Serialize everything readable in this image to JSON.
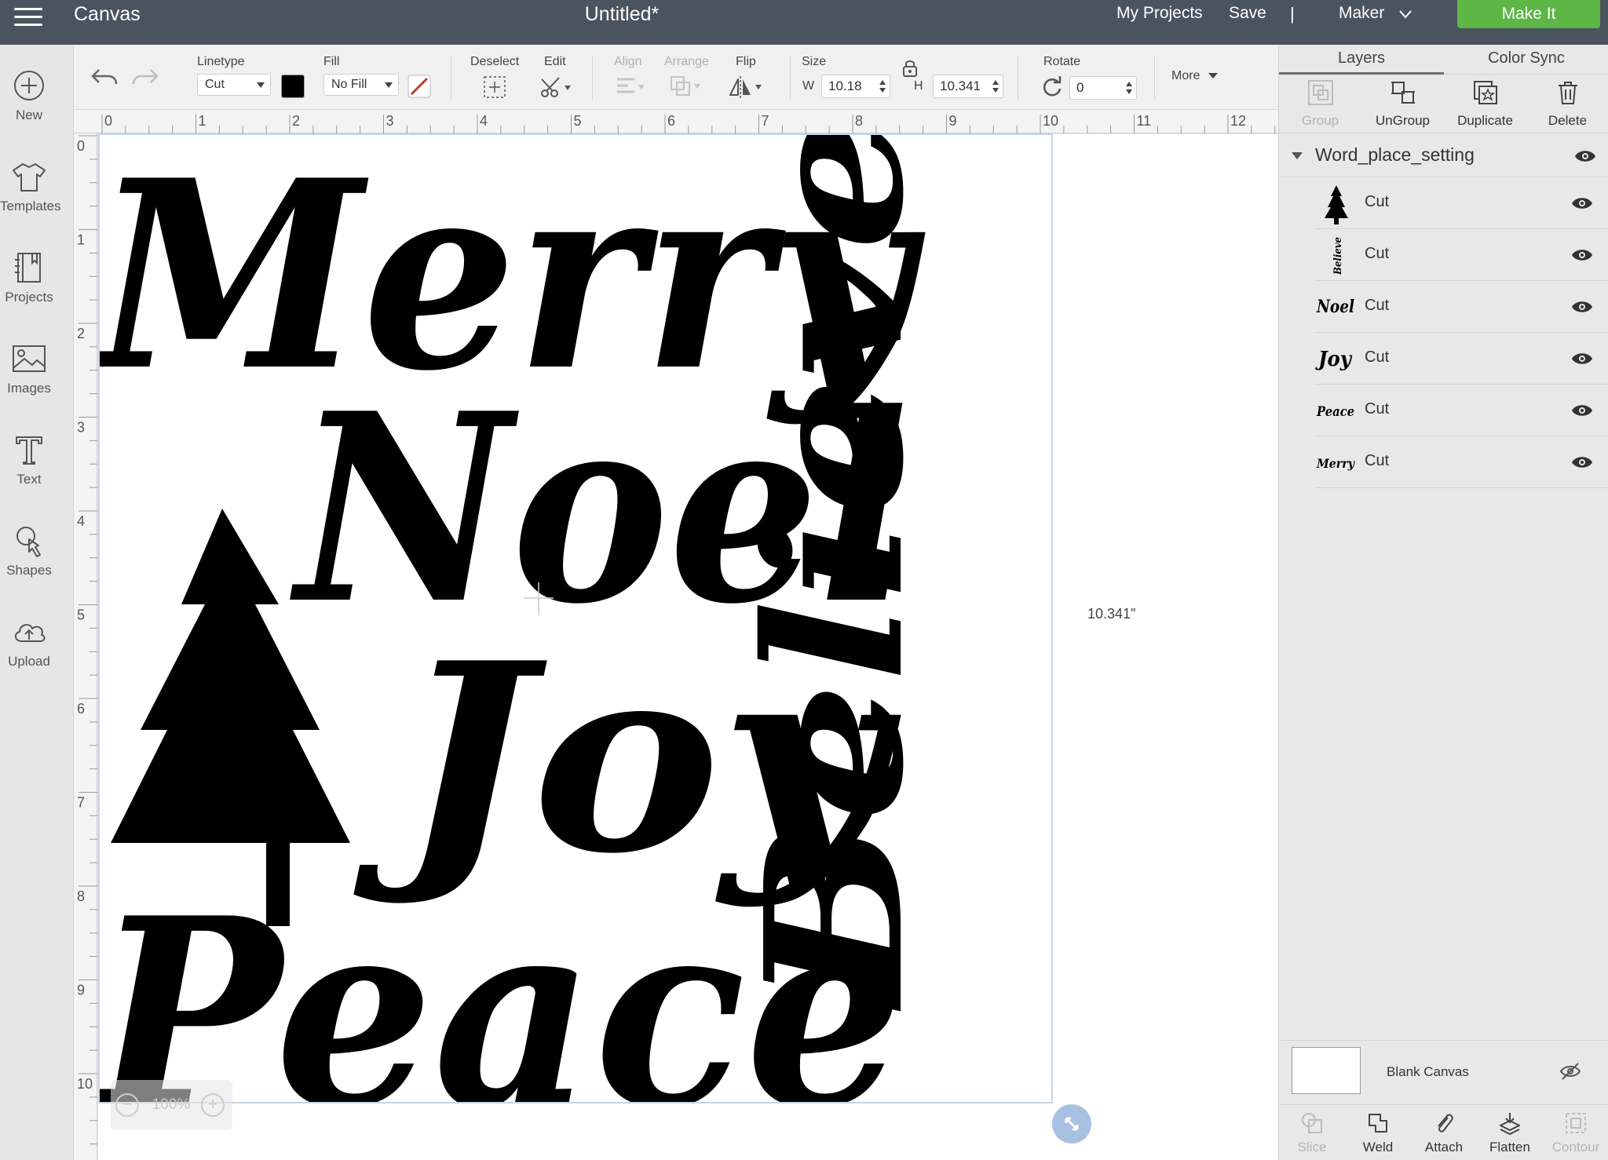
{
  "topbar": {
    "app_title": "Canvas",
    "doc_title": "Untitled*",
    "my_projects": "My Projects",
    "save": "Save",
    "separator": "|",
    "machine": "Maker",
    "make_it": "Make It",
    "make_it_color": "#5db645"
  },
  "nav": {
    "items": [
      {
        "label": "New",
        "icon": "plus-circle-icon"
      },
      {
        "label": "Templates",
        "icon": "tshirt-icon"
      },
      {
        "label": "Projects",
        "icon": "notebook-icon"
      },
      {
        "label": "Images",
        "icon": "image-icon"
      },
      {
        "label": "Text",
        "icon": "text-t-icon"
      },
      {
        "label": "Shapes",
        "icon": "shapes-icon"
      },
      {
        "label": "Upload",
        "icon": "cloud-upload-icon"
      }
    ]
  },
  "toolbar": {
    "linetype_label": "Linetype",
    "linetype_value": "Cut",
    "fill_label": "Fill",
    "fill_value": "No Fill",
    "deselect_label": "Deselect",
    "edit_label": "Edit",
    "align_label": "Align",
    "arrange_label": "Arrange",
    "flip_label": "Flip",
    "size_label": "Size",
    "w_label": "W",
    "w_value": "10.18",
    "h_label": "H",
    "h_value": "10.341",
    "rotate_label": "Rotate",
    "rotate_value": "0",
    "more_label": "More"
  },
  "ruler": {
    "top_ticks": [
      "0",
      "1",
      "2",
      "3",
      "4",
      "5",
      "6",
      "7",
      "8",
      "9",
      "10",
      "11",
      "12"
    ],
    "left_ticks": [
      "0",
      "1",
      "2",
      "3",
      "4",
      "5",
      "6",
      "7",
      "8",
      "9",
      "10"
    ]
  },
  "canvas": {
    "dimension_label": "10.341\"",
    "zoom": "100%",
    "words": {
      "merry": "Merry",
      "noel": "Noel",
      "joy": "Joy",
      "peace": "Peace",
      "believe": "Believe"
    }
  },
  "panel": {
    "tabs": [
      "Layers",
      "Color Sync"
    ],
    "actions": [
      {
        "label": "Group",
        "enabled": false,
        "icon": "group-icon"
      },
      {
        "label": "UnGroup",
        "enabled": true,
        "icon": "ungroup-icon"
      },
      {
        "label": "Duplicate",
        "enabled": true,
        "icon": "duplicate-icon"
      },
      {
        "label": "Delete",
        "enabled": true,
        "icon": "trash-icon"
      }
    ],
    "group_name": "Word_place_setting",
    "layers": [
      {
        "thumb": "tree",
        "name": "Cut"
      },
      {
        "thumb": "Believe",
        "name": "Cut"
      },
      {
        "thumb": "Noel",
        "name": "Cut"
      },
      {
        "thumb": "Joy",
        "name": "Cut"
      },
      {
        "thumb": "Peace",
        "name": "Cut"
      },
      {
        "thumb": "Merry",
        "name": "Cut"
      }
    ],
    "blank_canvas": "Blank Canvas",
    "bottom_actions": [
      {
        "label": "Slice",
        "enabled": false,
        "icon": "slice-icon"
      },
      {
        "label": "Weld",
        "enabled": true,
        "icon": "weld-icon"
      },
      {
        "label": "Attach",
        "enabled": true,
        "icon": "paperclip-icon"
      },
      {
        "label": "Flatten",
        "enabled": true,
        "icon": "flatten-icon"
      },
      {
        "label": "Contour",
        "enabled": false,
        "icon": "contour-icon"
      }
    ]
  }
}
